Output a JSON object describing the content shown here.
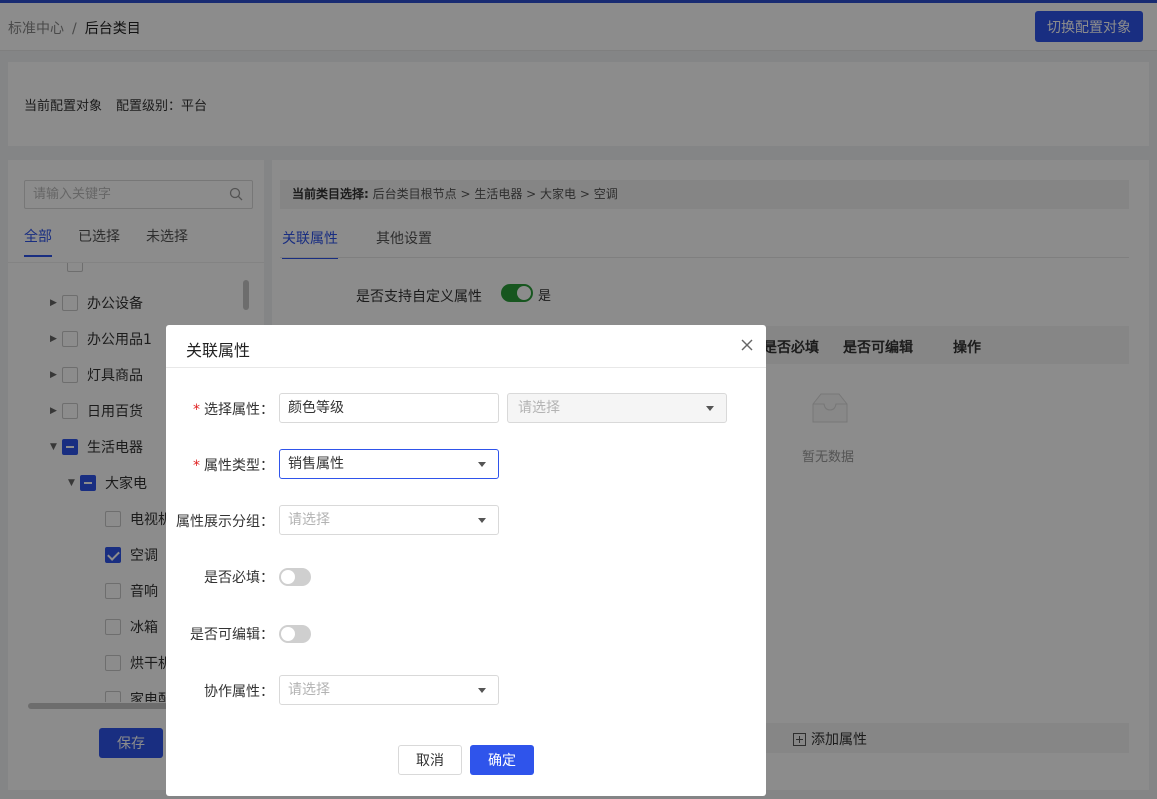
{
  "colors": {
    "accent": "#2f54eb",
    "toggle_on": "#2a9d3a",
    "required": "#e02020"
  },
  "header": {
    "breadcrumb_parent": "标准中心",
    "breadcrumb_sep": "/",
    "breadcrumb_current": "后台类目",
    "switch_button": "切换配置对象"
  },
  "config": {
    "target_label": "当前配置对象",
    "level_label": "配置级别：平台"
  },
  "left": {
    "search_placeholder": "请输入关键字",
    "tabs": [
      "全部",
      "已选择",
      "未选择"
    ],
    "tree": [
      {
        "label": "办公设备",
        "icon": "caret-right-icon",
        "state": "unchecked"
      },
      {
        "label": "办公用品1",
        "icon": "caret-right-icon",
        "state": "unchecked"
      },
      {
        "label": "灯具商品",
        "icon": "caret-right-icon",
        "state": "unchecked"
      },
      {
        "label": "日用百货",
        "icon": "caret-right-icon",
        "state": "unchecked"
      },
      {
        "label": "生活电器",
        "icon": "caret-down-icon",
        "state": "partial"
      },
      {
        "label": "大家电",
        "icon": "caret-down-icon",
        "state": "partial"
      },
      {
        "label": "电视机",
        "icon": "",
        "state": "unchecked"
      },
      {
        "label": "空调",
        "icon": "",
        "state": "checked"
      },
      {
        "label": "音响",
        "icon": "",
        "state": "unchecked"
      },
      {
        "label": "冰箱",
        "icon": "",
        "state": "unchecked"
      },
      {
        "label": "烘干机",
        "icon": "",
        "state": "unchecked"
      },
      {
        "label": "家电配",
        "icon": "",
        "state": "unchecked"
      }
    ],
    "save_button": "保存"
  },
  "right": {
    "current_label": "当前类目选择:",
    "current_path": "后台类目根节点 > 生活电器 > 大家电 > 空调",
    "tabs": [
      "关联属性",
      "其他设置"
    ],
    "custom_attr_label": "是否支持自定义属性",
    "custom_attr_value": "是",
    "table_headers": [
      "是否必填",
      "是否可编辑",
      "操作"
    ],
    "empty_text": "暂无数据",
    "add_attr": "添加属性"
  },
  "dialog": {
    "title": "关联属性",
    "attr_label": "选择属性：",
    "attr_value": "颜色等级",
    "attr_select_placeholder": "请选择",
    "type_label": "属性类型：",
    "type_value": "销售属性",
    "group_label": "属性展示分组：",
    "group_placeholder": "请选择",
    "required_label": "是否必填：",
    "editable_label": "是否可编辑：",
    "collab_label": "协作属性：",
    "collab_placeholder": "请选择",
    "cancel": "取消",
    "ok": "确定"
  }
}
